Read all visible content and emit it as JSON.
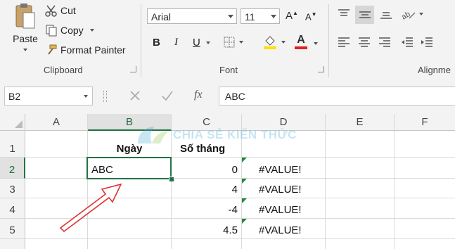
{
  "clipboard": {
    "paste_label": "Paste",
    "cut_label": "Cut",
    "copy_label": "Copy",
    "format_painter_label": "Format Painter",
    "group_label": "Clipboard"
  },
  "font": {
    "font_name": "Arial",
    "font_size": "11",
    "bold_label": "B",
    "italic_label": "I",
    "underline_label": "U",
    "font_color_label": "A",
    "highlight_color": "#ffe000",
    "font_color": "#e02020",
    "group_label": "Font"
  },
  "alignment": {
    "group_label": "Alignme"
  },
  "formula_bar": {
    "name_box": "B2",
    "formula_value": "ABC",
    "fx_label": "fx"
  },
  "sheet": {
    "columns": [
      "A",
      "B",
      "C",
      "D",
      "E",
      "F"
    ],
    "rows": [
      "1",
      "2",
      "3",
      "4",
      "5"
    ],
    "selected_cell": "B2",
    "cells": {
      "B1": "Ngày",
      "C1": "Số tháng",
      "B2": "ABC",
      "C2": "0",
      "D2": "#VALUE!",
      "C3": "4",
      "D3": "#VALUE!",
      "C4": "-4",
      "D4": "#VALUE!",
      "C5": "4.5",
      "D5": "#VALUE!"
    },
    "accent_color": "#217346"
  },
  "watermark": {
    "text": "CHIA SẺ KIẾN THỨC"
  }
}
